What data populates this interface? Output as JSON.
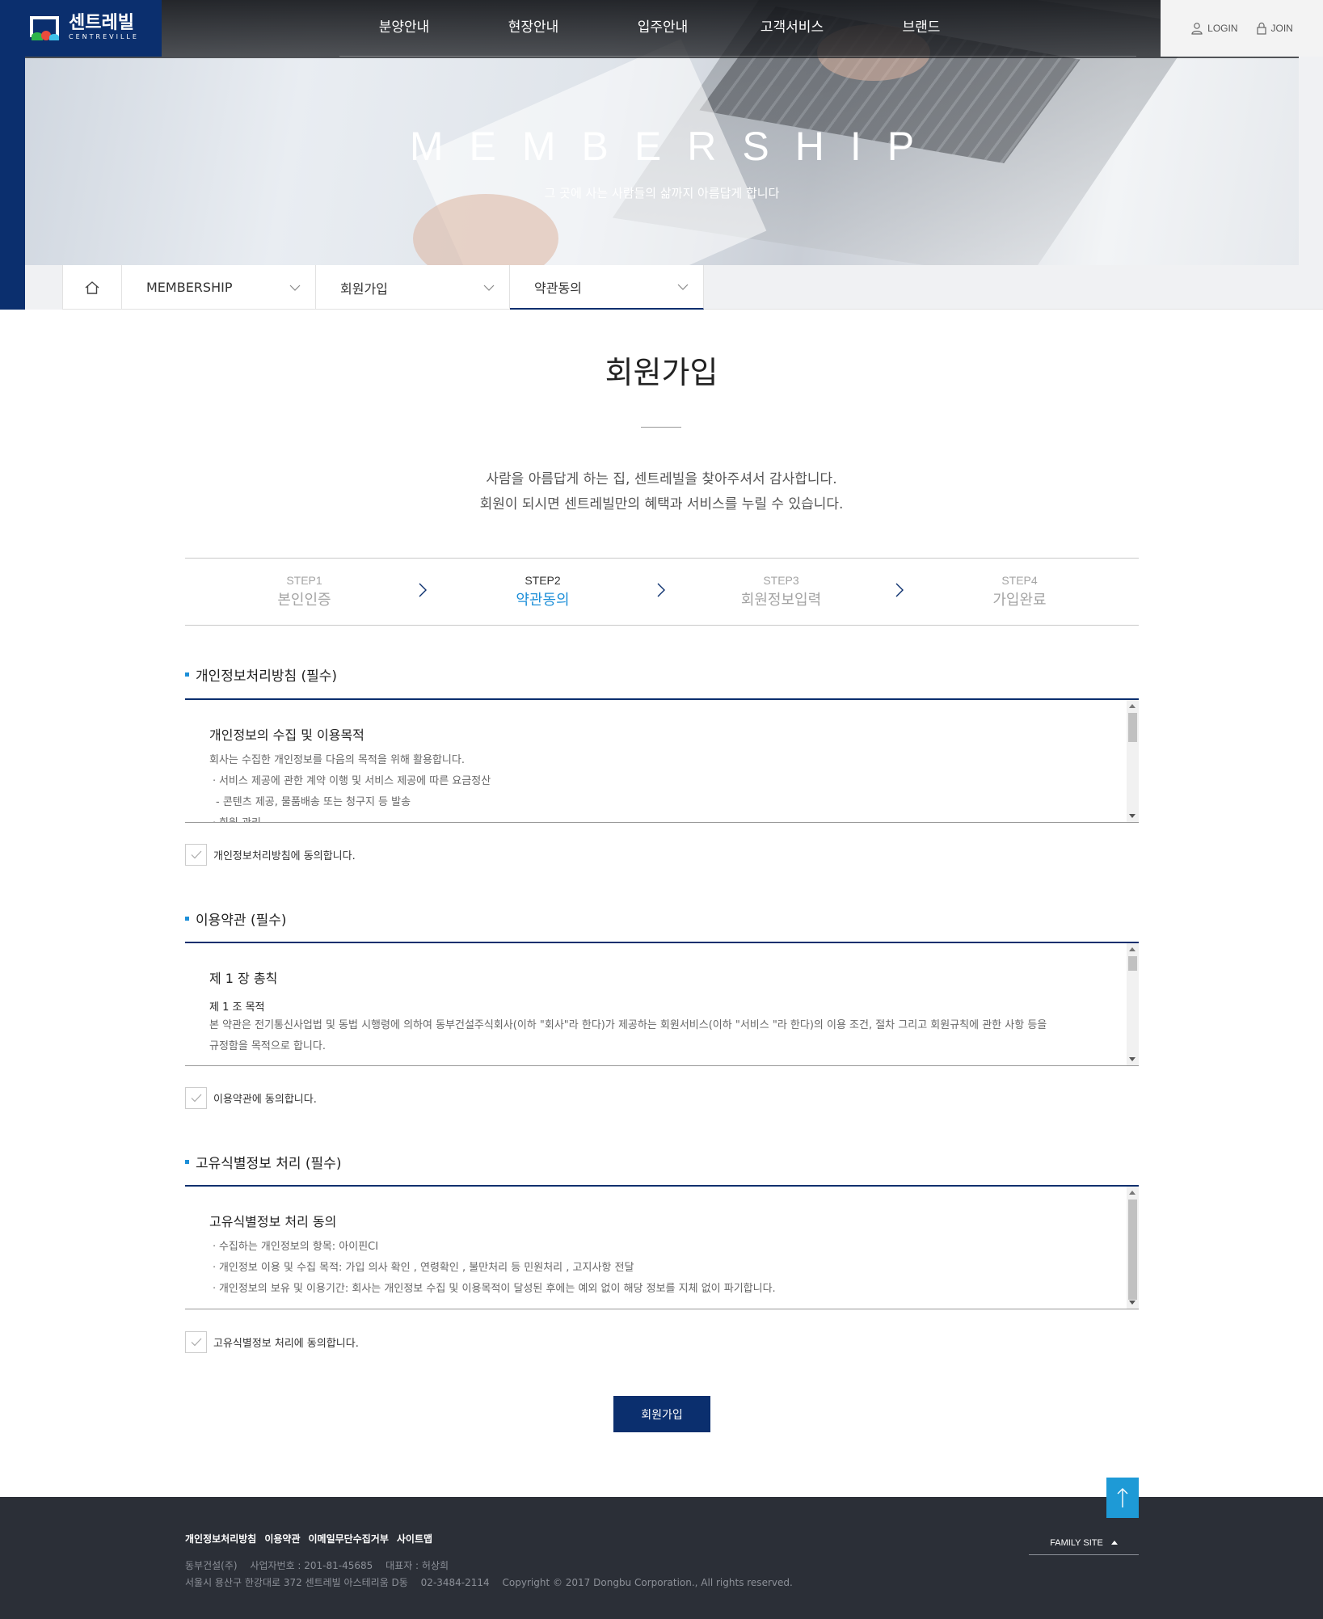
{
  "header": {
    "logo": {
      "ko": "센트레빌",
      "en": "CENTREVILLE"
    },
    "gnb": [
      "분양안내",
      "현장안내",
      "입주안내",
      "고객서비스",
      "브랜드"
    ],
    "util": {
      "login": "LOGIN",
      "join": "JOIN"
    },
    "hero_title": "MEMBERSHIP",
    "hero_subtitle": "그 곳에 사는 사람들의 삶까지 아름답게 합니다"
  },
  "location": {
    "items": [
      "MEMBERSHIP",
      "회원가입",
      "약관동의"
    ]
  },
  "main": {
    "title": "회원가입",
    "intro_lines": [
      "사람을 아름답게 하는 집, 센트레빌을 찾아주셔서 감사합니다.",
      "회원이 되시면 센트레빌만의 혜택과 서비스를 누릴 수 있습니다."
    ],
    "steps": [
      {
        "num": "STEP1",
        "label": "본인인증"
      },
      {
        "num": "STEP2",
        "label": "약관동의"
      },
      {
        "num": "STEP3",
        "label": "회원정보입력"
      },
      {
        "num": "STEP4",
        "label": "가입완료"
      }
    ],
    "sections": [
      {
        "title": "개인정보처리방침 (필수)",
        "heading": "개인정보의 수집 및 이용목적",
        "lines": [
          "회사는 수집한 개인정보를 다음의 목적을 위해 활용합니다.",
          "ㆍ서비스 제공에 관한 계약 이행 및 서비스 제공에 따른 요금정산",
          "  - 콘텐츠 제공, 물품배송 또는 청구지 등 발송",
          "ㆍ회원 관리"
        ],
        "agree": "개인정보처리방침에 동의합니다."
      },
      {
        "title": "이용약관 (필수)",
        "heading": "제 1 장 총칙",
        "subheading": "제 1 조 목적",
        "lines": [
          "본 약관은 전기통신사업법 및 동법 시행령에 의하여 동부건설주식회사(이하 \"회사\"라 한다)가 제공하는 회원서비스(이하 \"서비스 \"라 한다)의 이용 조건, 절차 그리고 회원규칙에 관한 사항 등을",
          "규정함을 목적으로 합니다."
        ],
        "agree": "이용약관에 동의합니다."
      },
      {
        "title": "고유식별정보 처리 (필수)",
        "heading": "고유식별정보 처리 동의",
        "lines": [
          "ㆍ수집하는 개인정보의 항목: 아이핀CI",
          "ㆍ개인정보 이용 및 수집 목적: 가입 의사 확인 , 연령확인 , 불만처리 등 민원처리 , 고지사항 전달",
          "ㆍ개인정보의 보유 및 이용기간: 회사는 개인정보 수집 및 이용목적이 달성된 후에는 예외 없이 해당 정보를 지체 없이 파기합니다."
        ],
        "agree": "고유식별정보 처리에 동의합니다."
      }
    ],
    "submit_label": "회원가입"
  },
  "footer": {
    "links": [
      "개인정보처리방침",
      "이용약관",
      "이메일무단수집거부",
      "사이트맵"
    ],
    "company": "동부건설(주)",
    "bizno": "사업자번호 : 201-81-45685",
    "ceo": "대표자 : 허상희",
    "address": "서울시 용산구 한강대로 372 센트레빌 아스테리움 D동",
    "phone": "02-3484-2114",
    "copyright": "Copyright © 2017 Dongbu Corporation., All rights reserved.",
    "family_site": "FAMILY SITE"
  },
  "colors": {
    "brand_navy": "#0b2f6e",
    "accent_blue": "#1d8fd8",
    "footer_bg": "#2b2f37"
  }
}
